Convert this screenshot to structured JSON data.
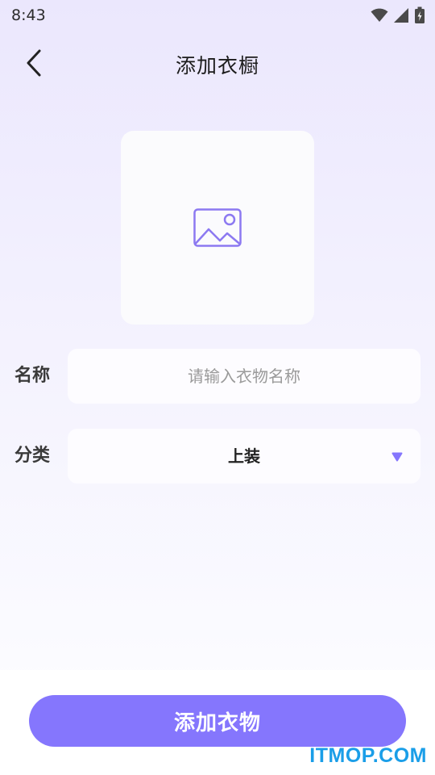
{
  "status_bar": {
    "time": "8:43",
    "icons": [
      "wifi-icon",
      "signal-icon",
      "battery-icon"
    ]
  },
  "header": {
    "back_icon": "chevron-left-icon",
    "title": "添加衣橱"
  },
  "image_picker": {
    "icon": "image-placeholder-icon"
  },
  "form": {
    "name": {
      "label": "名称",
      "value": "",
      "placeholder": "请输入衣物名称"
    },
    "category": {
      "label": "分类",
      "value": "上装",
      "dropdown_icon": "triangle-down-icon"
    }
  },
  "submit": {
    "label": "添加衣物"
  },
  "watermark": {
    "text": "ITMOP.COM"
  },
  "colors": {
    "accent": "#8576fd",
    "icon_purple": "#8c79f1",
    "watermark": "#1a9ee8"
  }
}
